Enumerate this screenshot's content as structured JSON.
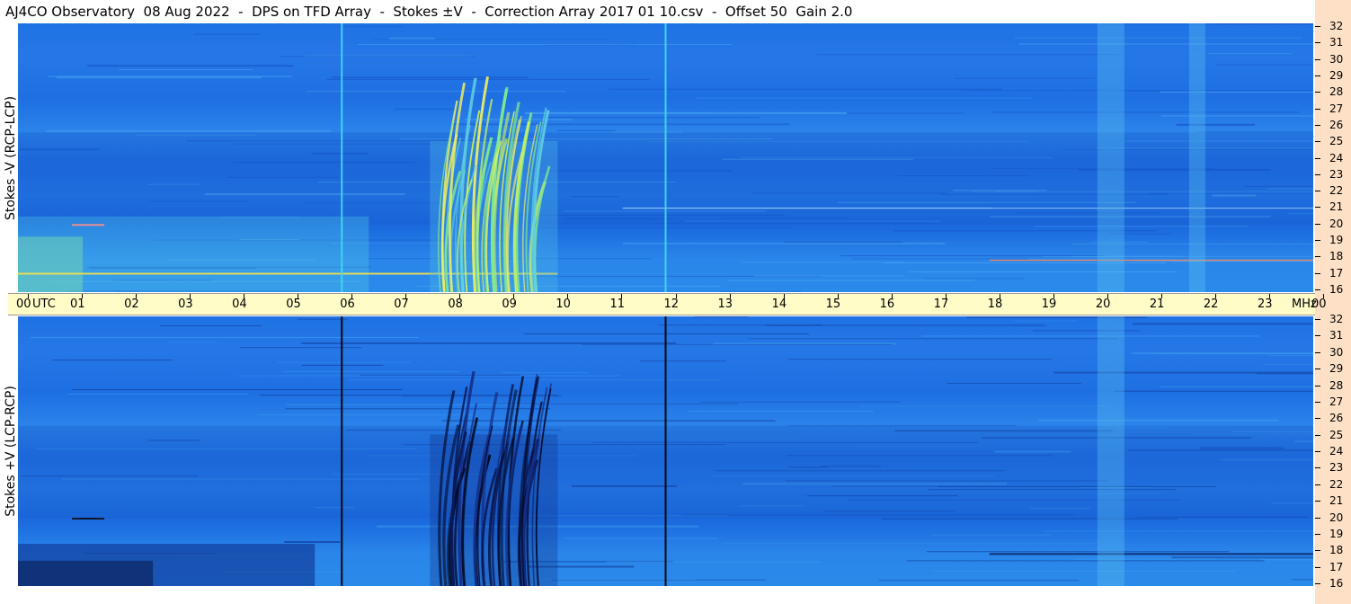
{
  "title": "AJ4CO Observatory  08 Aug 2022  -  DPS on TFD Array  -  Stokes ±V  -  Correction Array 2017 01 10.csv  -  Offset 50  Gain 2.0",
  "chart_data": [
    {
      "type": "heatmap",
      "ylabel": "Stokes -V (RCP-LCP)",
      "xlabel": "UTC",
      "x_ticks": [
        "00",
        "01",
        "02",
        "03",
        "04",
        "05",
        "06",
        "07",
        "08",
        "09",
        "10",
        "11",
        "12",
        "13",
        "14",
        "15",
        "16",
        "17",
        "18",
        "19",
        "20",
        "21",
        "22",
        "23",
        "00"
      ],
      "x_range_utc_hours": [
        0,
        24
      ],
      "y_unit": "MHz",
      "y_ticks": [
        32,
        31,
        30,
        29,
        28,
        27,
        26,
        25,
        24,
        23,
        22,
        21,
        20,
        19,
        18,
        17,
        16
      ],
      "y_range_mhz": [
        16,
        32
      ],
      "colormap": "blue (low) - cyan - yellow - red (high)",
      "features": [
        {
          "kind": "vertical line",
          "utc_hour": 6.0,
          "color": "cyan"
        },
        {
          "kind": "vertical line",
          "utc_hour": 12.0,
          "color": "cyan"
        },
        {
          "kind": "burst",
          "utc_start": 7.3,
          "utc_end": 10.0,
          "mhz_low": 16,
          "mhz_high": 29,
          "color": "yellow-green"
        },
        {
          "kind": "broadband enhancement",
          "utc_start": 20.0,
          "utc_end": 20.5,
          "color": "light blue"
        },
        {
          "kind": "broadband enhancement",
          "utc_start": 21.7,
          "utc_end": 22.0,
          "color": "light blue"
        }
      ]
    },
    {
      "type": "heatmap",
      "ylabel": "Stokes +V (LCP-RCP)",
      "xlabel": "UTC",
      "x_ticks": [
        "00",
        "01",
        "02",
        "03",
        "04",
        "05",
        "06",
        "07",
        "08",
        "09",
        "10",
        "11",
        "12",
        "13",
        "14",
        "15",
        "16",
        "17",
        "18",
        "19",
        "20",
        "21",
        "22",
        "23",
        "00"
      ],
      "x_range_utc_hours": [
        0,
        24
      ],
      "y_unit": "MHz",
      "y_ticks": [
        32,
        31,
        30,
        29,
        28,
        27,
        26,
        25,
        24,
        23,
        22,
        21,
        20,
        19,
        18,
        17,
        16
      ],
      "y_range_mhz": [
        16,
        32
      ],
      "colormap": "black (low) - dark blue - blue - cyan - yellow (high)",
      "features": [
        {
          "kind": "vertical line",
          "utc_hour": 6.0,
          "color": "black"
        },
        {
          "kind": "vertical line",
          "utc_hour": 12.0,
          "color": "black"
        },
        {
          "kind": "burst",
          "utc_start": 7.3,
          "utc_end": 10.0,
          "mhz_low": 16,
          "mhz_high": 29,
          "color": "dark blue / black"
        },
        {
          "kind": "broadband enhancement",
          "utc_start": 20.0,
          "utc_end": 20.5,
          "color": "light blue"
        }
      ]
    }
  ],
  "axis": {
    "utc_label": "UTC",
    "mhz_label": "MHz"
  }
}
